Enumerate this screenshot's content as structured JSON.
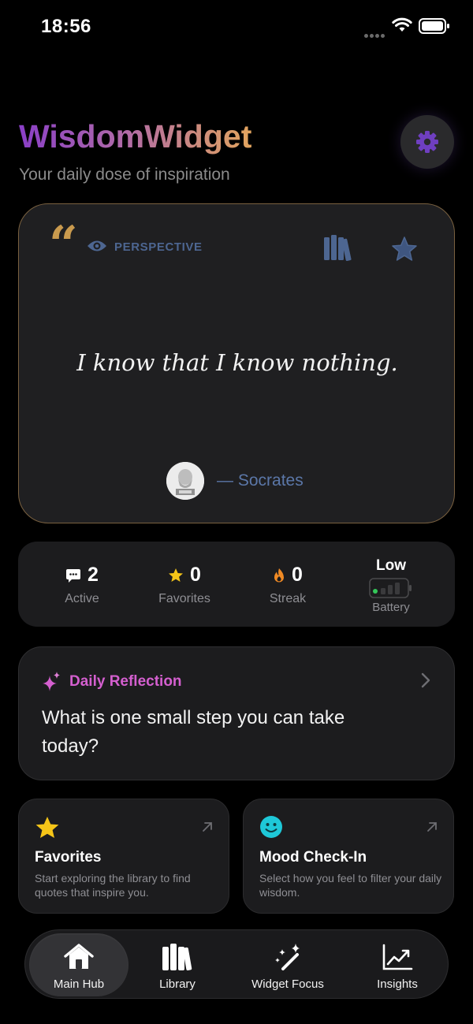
{
  "status_bar": {
    "time": "18:56"
  },
  "header": {
    "title": "WisdomWidget",
    "subtitle": "Your daily dose of inspiration"
  },
  "quote_card": {
    "quote_mark": "“",
    "category": "PERSPECTIVE",
    "text": "I know that I know nothing.",
    "author": "— Socrates"
  },
  "stats": [
    {
      "value": "2",
      "label": "Active",
      "icon": "chat-bubble-icon"
    },
    {
      "value": "0",
      "label": "Favorites",
      "icon": "star-icon"
    },
    {
      "value": "0",
      "label": "Streak",
      "icon": "flame-icon"
    }
  ],
  "battery_stat": {
    "level": "Low",
    "label": "Battery",
    "fill_fraction": 0.25
  },
  "reflection": {
    "title": "Daily Reflection",
    "text": "What is one small step you can take today?"
  },
  "tiles": [
    {
      "title": "Favorites",
      "description": "Start exploring the library to find quotes that inspire you.",
      "icon": "star-icon"
    },
    {
      "title": "Mood Check-In",
      "description": "Select how you feel to filter your daily wisdom.",
      "icon": "smiley-icon"
    }
  ],
  "tabs": [
    {
      "label": "Main Hub",
      "icon": "house-icon"
    },
    {
      "label": "Library",
      "icon": "books-icon"
    },
    {
      "label": "Widget Focus",
      "icon": "magic-wand-icon"
    },
    {
      "label": "Insights",
      "icon": "chart-icon"
    }
  ],
  "colors": {
    "accent_gold": "#c99a4e",
    "category_blue": "#4d6691",
    "reflection_pink": "#d45fcf",
    "settings_purple": "#6f3fc0"
  }
}
